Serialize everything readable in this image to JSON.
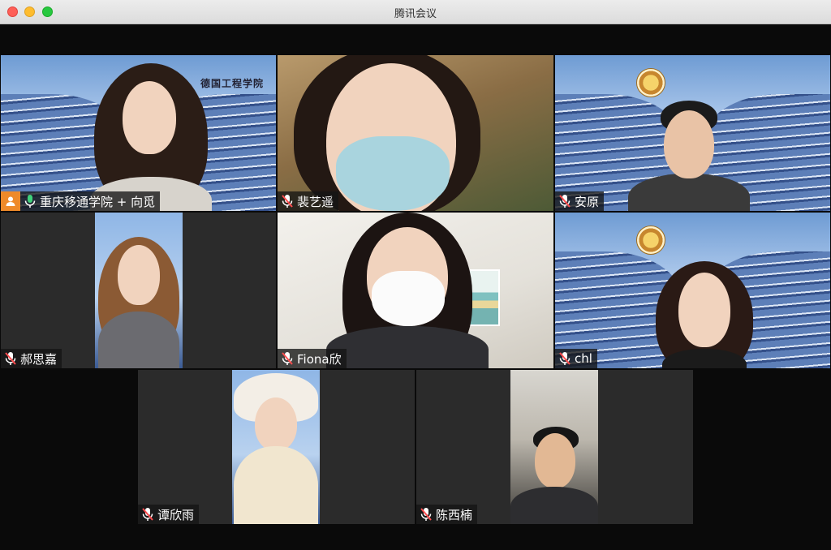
{
  "window": {
    "title": "腾讯会议"
  },
  "participants": {
    "p1": {
      "name": "重庆移通学院 + 向觅",
      "logo_text": "德国工程学院",
      "mic": "on"
    },
    "p2": {
      "name": "裴艺遥",
      "mic": "muted"
    },
    "p3": {
      "name": "安原",
      "mic": "muted"
    },
    "p4": {
      "name": "郝思嘉",
      "mic": "muted"
    },
    "p5": {
      "name": "Fiona欣",
      "mic": "muted"
    },
    "p6": {
      "name": "chl",
      "mic": "muted"
    },
    "p7": {
      "name": "谭欣雨",
      "mic": "muted"
    },
    "p8": {
      "name": "陈西楠",
      "mic": "muted"
    }
  },
  "colors": {
    "host_badge": "#ee8a2a",
    "label_bg": "#141414",
    "mic_on": "#ffffff"
  },
  "icons": {
    "host": "person-icon",
    "muted": "mic-muted-icon",
    "unmuted": "mic-icon"
  }
}
